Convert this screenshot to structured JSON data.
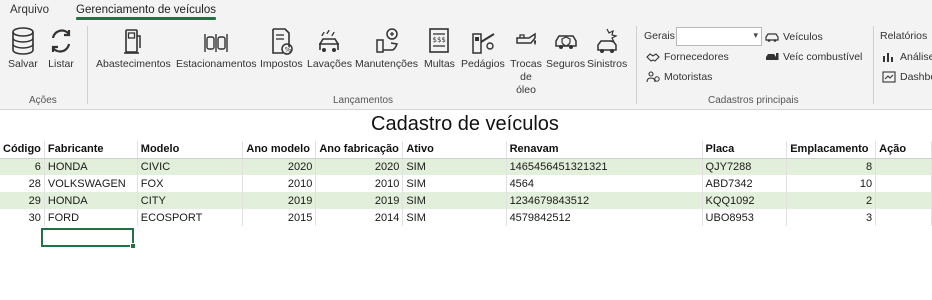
{
  "tabs": [
    "Arquivo",
    "Gerenciamento de veículos"
  ],
  "ribbon": {
    "acoes": {
      "label": "Ações",
      "buttons": [
        "Salvar",
        "Listar"
      ]
    },
    "lancamentos": {
      "label": "Lançamentos",
      "buttons": [
        "Abastecimentos",
        "Estacionamentos",
        "Impostos",
        "Lavações",
        "Manutenções",
        "Multas",
        "Pedágios",
        "Trocas de óleo",
        "Seguros",
        "Sinistros"
      ]
    },
    "cadastros": {
      "label": "Cadastros principais",
      "gerais_label": "Gerais",
      "combo_value": "",
      "items": [
        "Veículos",
        "Fornecedores",
        "Veíc combustível",
        "Motoristas"
      ]
    },
    "relatorios": {
      "label": "Relatórios",
      "items": [
        "Análise",
        "Dashbo"
      ]
    }
  },
  "sheet": {
    "title": "Cadastro de veículos",
    "headers": [
      "Código",
      "Fabricante",
      "Modelo",
      "Ano modelo",
      "Ano fabricação",
      "Ativo",
      "Renavam",
      "Placa",
      "Emplacamento",
      "Ação"
    ],
    "rows": [
      [
        "6",
        "HONDA",
        "CIVIC",
        "2020",
        "2020",
        "SIM",
        "1465456451321321",
        "QJY7288",
        "8",
        ""
      ],
      [
        "28",
        "VOLKSWAGEN",
        "FOX",
        "2010",
        "2010",
        "SIM",
        "4564",
        "ABD7342",
        "10",
        ""
      ],
      [
        "29",
        "HONDA",
        "CITY",
        "2019",
        "2019",
        "SIM",
        "1234679843512",
        "KQQ1092",
        "2",
        ""
      ],
      [
        "30",
        "FORD",
        "ECOSPORT",
        "2015",
        "2014",
        "SIM",
        "4579842512",
        "UBO8953",
        "3",
        ""
      ]
    ]
  },
  "colors": {
    "accent": "#217346",
    "band": "#e2efda"
  }
}
